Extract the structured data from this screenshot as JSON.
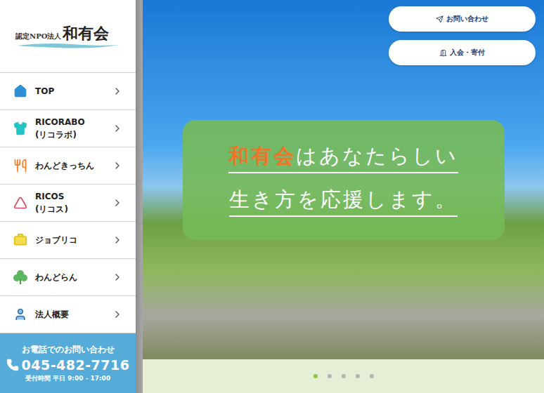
{
  "logo": {
    "subtitle": "認定NPO法人",
    "name": "和有会"
  },
  "sidebar": {
    "items": [
      {
        "lines": [
          "TOP"
        ]
      },
      {
        "lines": [
          "RICORABO",
          "(リコラボ)"
        ]
      },
      {
        "lines": [
          "わんどきっちん"
        ]
      },
      {
        "lines": [
          "RICOS",
          "(リコス)"
        ]
      },
      {
        "lines": [
          "ジョブリコ"
        ]
      },
      {
        "lines": [
          "わんどらん"
        ]
      },
      {
        "lines": [
          "法人概要"
        ]
      }
    ]
  },
  "contact": {
    "title": "お電話でのお問い合わせ",
    "phone": "045-482-7716",
    "hours": "受付時間 平日 9:00 - 17:00"
  },
  "header_buttons": [
    "お問い合わせ",
    "入会・寄付"
  ],
  "headline": {
    "highlight": "和有会",
    "line1": "はあなたらしい",
    "line2": "生き方を応援します。"
  },
  "slides": [
    {
      "selected": true
    },
    {
      "selected": false
    },
    {
      "selected": false
    },
    {
      "selected": false
    },
    {
      "selected": false
    }
  ]
}
